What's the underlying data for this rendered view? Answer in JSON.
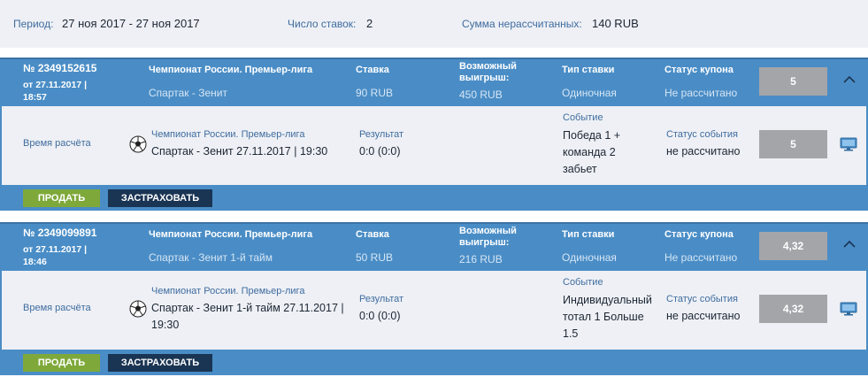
{
  "summary": {
    "period_label": "Период:",
    "period_value": "27 ноя 2017 - 27 ноя 2017",
    "bets_count_label": "Число ставок:",
    "bets_count_value": "2",
    "unsettled_label": "Сумма нерассчитанных:",
    "unsettled_value": "140 RUB"
  },
  "coupons": [
    {
      "number": "№ 2349152615",
      "date": "от 27.11.2017 | 18:57",
      "tournament": "Чемпионат России. Премьер-лига",
      "match": "Спартак - Зенит",
      "stake_label": "Ставка",
      "stake_value": "90 RUB",
      "win_label": "Возможный выигрыш:",
      "win_value": "450 RUB",
      "type_label": "Тип ставки",
      "type_value": "Одиночная",
      "status_label": "Статус купона",
      "status_value": "Не рассчитано",
      "odds": "5",
      "event": {
        "calc_label": "Время расчёта",
        "tournament": "Чемпионат России. Премьер-лига",
        "match_line1": "Спартак - Зенит 27.11.2017 | 19:30",
        "match_line2": "",
        "result_label": "Результат",
        "result_value": "0:0 (0:0)",
        "event_label": "Событие",
        "event_line1": "Победа 1 +",
        "event_line2": "команда 2",
        "event_line3": "забьет",
        "event_status_label": "Статус события",
        "event_status_value": "не рассчитано",
        "odds": "5"
      },
      "sell_label": "ПРОДАТЬ",
      "insure_label": "ЗАСТРАХОВАТЬ"
    },
    {
      "number": "№ 2349099891",
      "date": "от 27.11.2017 | 18:46",
      "tournament": "Чемпионат России. Премьер-лига",
      "match": "Спартак - Зенит 1-й тайм",
      "stake_label": "Ставка",
      "stake_value": "50 RUB",
      "win_label": "Возможный выигрыш:",
      "win_value": "216 RUB",
      "type_label": "Тип ставки",
      "type_value": "Одиночная",
      "status_label": "Статус купона",
      "status_value": "Не рассчитано",
      "odds": "4,32",
      "event": {
        "calc_label": "Время расчёта",
        "tournament": "Чемпионат России. Премьер-лига",
        "match_line1": "Спартак - Зенит 1-й тайм 27.11.2017 |",
        "match_line2": "19:30",
        "result_label": "Результат",
        "result_value": "0:0 (0:0)",
        "event_label": "Событие",
        "event_line1": "Индивидуальный",
        "event_line2": "тотал 1 Больше",
        "event_line3": "1.5",
        "event_status_label": "Статус события",
        "event_status_value": "не рассчитано",
        "odds": "4,32"
      },
      "sell_label": "ПРОДАТЬ",
      "insure_label": "ЗАСТРАХОВАТЬ"
    }
  ],
  "colors": {
    "header_blue": "#4a8dc6",
    "panel_bg": "#eef0f5",
    "label_blue": "#3f6c9f",
    "odds_grey": "#a4a5a9",
    "sell_green": "#7ea93a",
    "insure_navy": "#1a3453"
  },
  "icons": {
    "collapse": "chevron-up-icon",
    "sport": "soccer-ball-icon",
    "broadcast": "monitor-icon"
  }
}
